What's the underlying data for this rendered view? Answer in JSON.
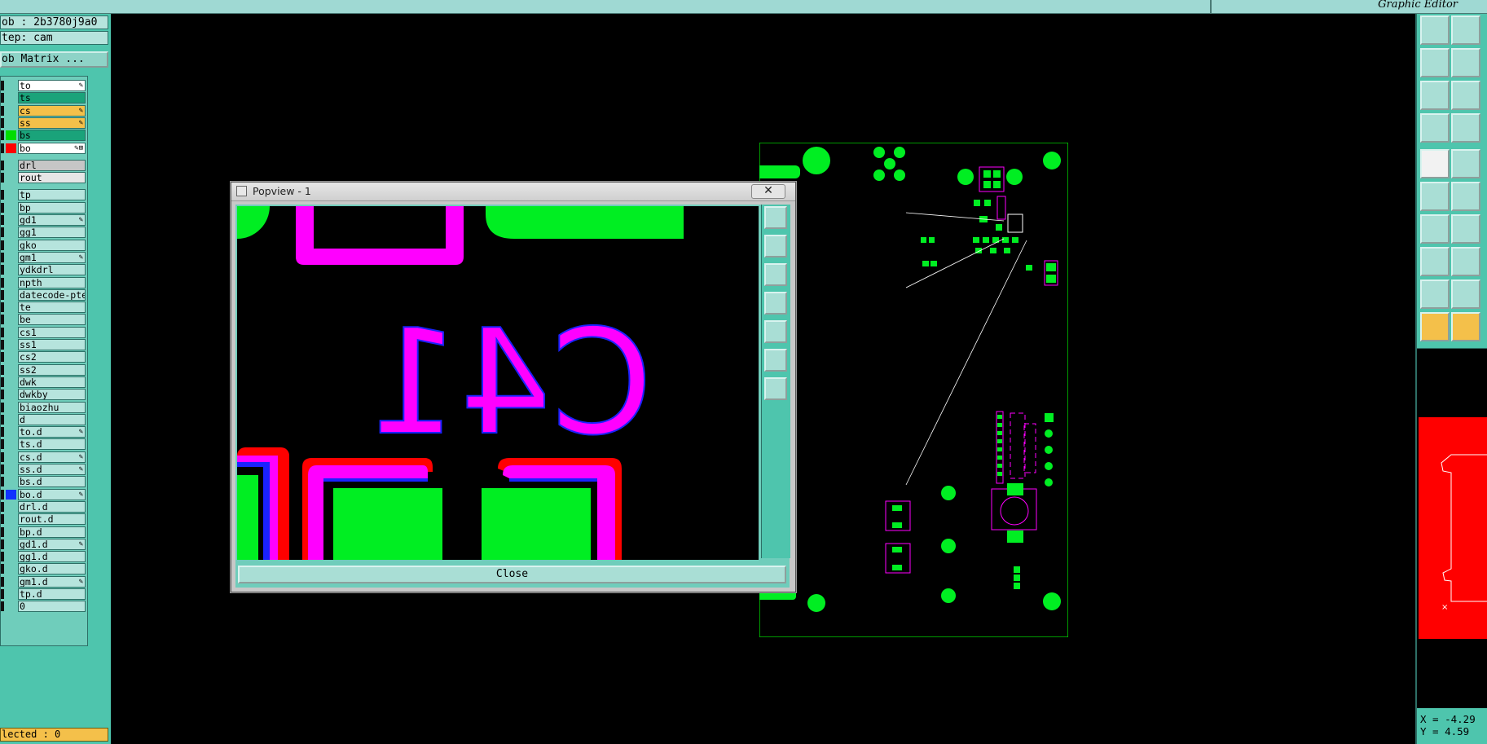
{
  "app": {
    "title": "Graphic Editor"
  },
  "job": {
    "job_line": "ob : 2b3780j9a0",
    "step_line": "tep: cam",
    "matrix_button": "ob Matrix ..."
  },
  "layers": [
    {
      "name": "to",
      "bg": "#ffffff",
      "mark": "✎",
      "swatch": ""
    },
    {
      "name": "ts",
      "bg": "#1aa37a",
      "mark": "",
      "swatch": ""
    },
    {
      "name": "cs",
      "bg": "#f4c04a",
      "mark": "✎",
      "swatch": ""
    },
    {
      "name": "ss",
      "bg": "#f4c04a",
      "mark": "✎",
      "swatch": ""
    },
    {
      "name": "bs",
      "bg": "#1aa37a",
      "mark": "",
      "swatch": "#00dd00"
    },
    {
      "name": "bo",
      "bg": "#ffffff",
      "mark": "✎⊞",
      "swatch": "#ff0000"
    },
    {
      "name": "drl",
      "bg": "#c6c6c6",
      "mark": "",
      "swatch": "",
      "gap": true
    },
    {
      "name": "rout",
      "bg": "#e6e6e6",
      "mark": "",
      "swatch": ""
    },
    {
      "name": "tp",
      "bg": "#b6e4dd",
      "mark": "",
      "swatch": "",
      "gap": true
    },
    {
      "name": "bp",
      "bg": "#b6e4dd",
      "mark": "",
      "swatch": ""
    },
    {
      "name": "gd1",
      "bg": "#b6e4dd",
      "mark": "✎",
      "swatch": ""
    },
    {
      "name": "gg1",
      "bg": "#b6e4dd",
      "mark": "",
      "swatch": ""
    },
    {
      "name": "gko",
      "bg": "#b6e4dd",
      "mark": "",
      "swatch": ""
    },
    {
      "name": "gm1",
      "bg": "#b6e4dd",
      "mark": "✎",
      "swatch": ""
    },
    {
      "name": "ydkdrl",
      "bg": "#b6e4dd",
      "mark": "",
      "swatch": ""
    },
    {
      "name": "npth",
      "bg": "#b6e4dd",
      "mark": "",
      "swatch": ""
    },
    {
      "name": "datecode-pte",
      "bg": "#b6e4dd",
      "mark": "",
      "swatch": ""
    },
    {
      "name": "te",
      "bg": "#b6e4dd",
      "mark": "",
      "swatch": ""
    },
    {
      "name": "be",
      "bg": "#b6e4dd",
      "mark": "",
      "swatch": ""
    },
    {
      "name": "cs1",
      "bg": "#b6e4dd",
      "mark": "",
      "swatch": ""
    },
    {
      "name": "ss1",
      "bg": "#b6e4dd",
      "mark": "",
      "swatch": ""
    },
    {
      "name": "cs2",
      "bg": "#b6e4dd",
      "mark": "",
      "swatch": ""
    },
    {
      "name": "ss2",
      "bg": "#b6e4dd",
      "mark": "",
      "swatch": ""
    },
    {
      "name": "dwk",
      "bg": "#b6e4dd",
      "mark": "",
      "swatch": ""
    },
    {
      "name": "dwkby",
      "bg": "#b6e4dd",
      "mark": "",
      "swatch": ""
    },
    {
      "name": "biaozhu",
      "bg": "#b6e4dd",
      "mark": "",
      "swatch": ""
    },
    {
      "name": "d",
      "bg": "#b6e4dd",
      "mark": "",
      "swatch": ""
    },
    {
      "name": "to.d",
      "bg": "#b6e4dd",
      "mark": "✎",
      "swatch": ""
    },
    {
      "name": "ts.d",
      "bg": "#b6e4dd",
      "mark": "",
      "swatch": ""
    },
    {
      "name": "cs.d",
      "bg": "#b6e4dd",
      "mark": "✎",
      "swatch": ""
    },
    {
      "name": "ss.d",
      "bg": "#b6e4dd",
      "mark": "✎",
      "swatch": ""
    },
    {
      "name": "bs.d",
      "bg": "#b6e4dd",
      "mark": "",
      "swatch": ""
    },
    {
      "name": "bo.d",
      "bg": "#b6e4dd",
      "mark": "✎",
      "swatch": "#1133ff"
    },
    {
      "name": "drl.d",
      "bg": "#b6e4dd",
      "mark": "",
      "swatch": ""
    },
    {
      "name": "rout.d",
      "bg": "#b6e4dd",
      "mark": "",
      "swatch": ""
    },
    {
      "name": "bp.d",
      "bg": "#b6e4dd",
      "mark": "",
      "swatch": ""
    },
    {
      "name": "gd1.d",
      "bg": "#b6e4dd",
      "mark": "✎",
      "swatch": ""
    },
    {
      "name": "gg1.d",
      "bg": "#b6e4dd",
      "mark": "",
      "swatch": ""
    },
    {
      "name": "gko.d",
      "bg": "#b6e4dd",
      "mark": "",
      "swatch": ""
    },
    {
      "name": "gm1.d",
      "bg": "#b6e4dd",
      "mark": "✎",
      "swatch": ""
    },
    {
      "name": "tp.d",
      "bg": "#b6e4dd",
      "mark": "",
      "swatch": ""
    },
    {
      "name": "0",
      "bg": "#b6e4dd",
      "mark": "",
      "swatch": ""
    }
  ],
  "status": {
    "selected": "lected : 0"
  },
  "popview": {
    "title": "Popview - 1",
    "close_x": "✕",
    "close_button": "Close",
    "reference_text": "C41",
    "tools": [
      "fit-icon",
      "zoom-out-icon",
      "zoom-in-icon",
      "pan-left-icon",
      "pan-right-icon",
      "zoom-extents-icon",
      "zoom-window-icon"
    ]
  },
  "coords": {
    "x": "X = -4.29",
    "y": "Y = 4.59"
  },
  "colors": {
    "bg_cyan": "#4ec5ad",
    "light_cyan": "#b6e4dd",
    "board_green": "#00dd00",
    "pad_green": "#00ee22",
    "silkscreen_magenta": "#ff00ff",
    "highlight_red": "#ff0000",
    "outline_blue": "#1a22ff",
    "selected_orange": "#f4c04a"
  }
}
